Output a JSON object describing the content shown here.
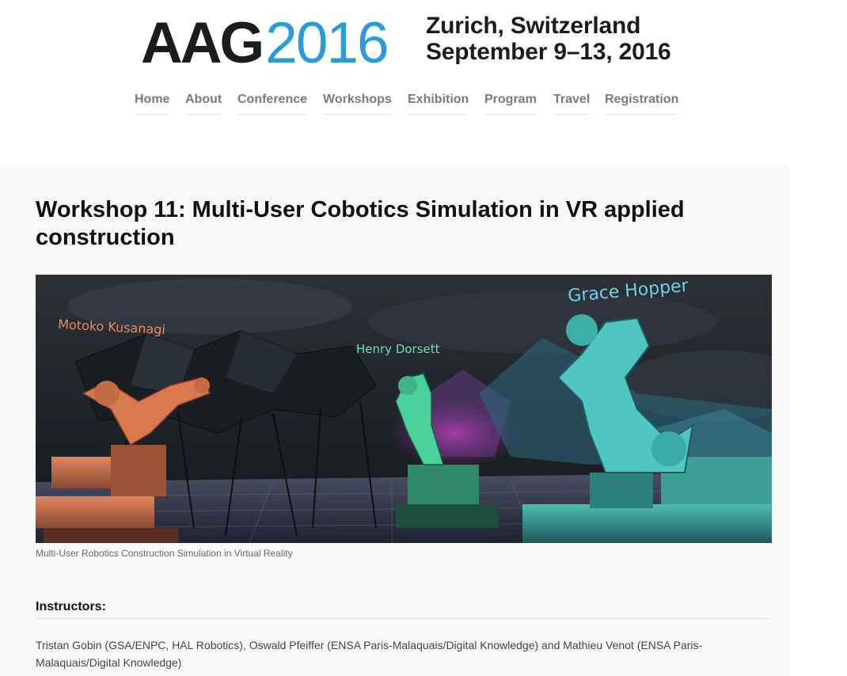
{
  "logo": {
    "brand": "AAG",
    "year": "2016",
    "location": "Zurich, Switzerland",
    "dates": "September 9–13, 2016",
    "colors": {
      "brand": "#1c1c1c",
      "year": "#2a9bd7"
    }
  },
  "nav": {
    "items": [
      {
        "label": "Home"
      },
      {
        "label": "About"
      },
      {
        "label": "Conference"
      },
      {
        "label": "Workshops"
      },
      {
        "label": "Exhibition"
      },
      {
        "label": "Program"
      },
      {
        "label": "Travel"
      },
      {
        "label": "Registration"
      }
    ]
  },
  "article": {
    "title": "Workshop 11: Multi-User Cobotics Simulation in VR applied construction",
    "figure": {
      "labels": {
        "robot1": "Motoko Kusanagi",
        "robot2": "Henry Dorsett",
        "robot3": "Grace Hopper"
      },
      "caption": "Multi-User Robotics Construction Simulation in Virtual Reality"
    },
    "instructors_heading": "Instructors:",
    "instructors_text": "Tristan Gobin (GSA/ENPC, HAL Robotics), Oswald Pfeiffer (ENSA Paris-Malaquais/Digital Knowledge) and Mathieu Venot (ENSA Paris-Malaquais/Digital Knowledge)"
  }
}
